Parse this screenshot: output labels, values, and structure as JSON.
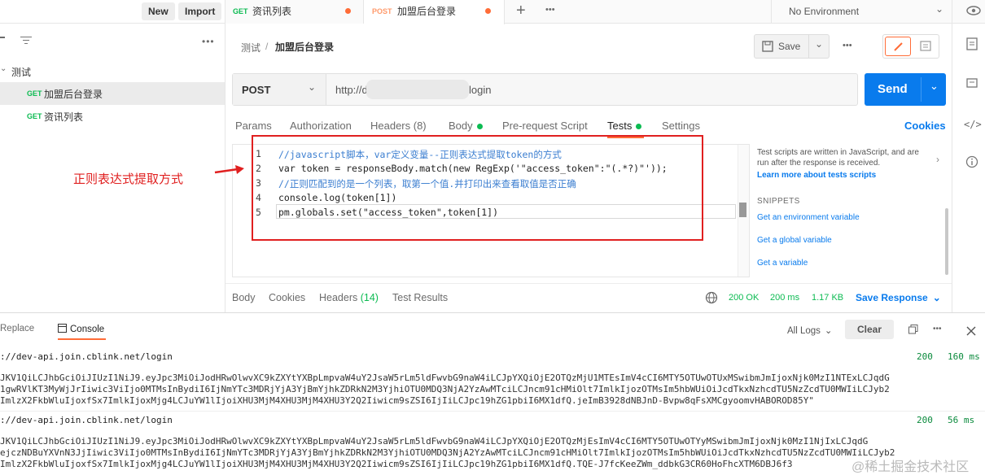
{
  "sidebar": {
    "new_label": "New",
    "import_label": "Import",
    "collection_name": "测试",
    "items": [
      {
        "method": "GET",
        "name": "加盟后台登录"
      },
      {
        "method": "GET",
        "name": "资讯列表"
      }
    ]
  },
  "tabs": [
    {
      "method": "GET",
      "name": "资讯列表"
    },
    {
      "method": "POST",
      "name": "加盟后台登录"
    }
  ],
  "environment": "No Environment",
  "breadcrumb": {
    "parent": "测试",
    "sep": "/",
    "current": "加盟后台登录"
  },
  "toolbar": {
    "save_label": "Save"
  },
  "request": {
    "method": "POST",
    "url_start": "http://d",
    "url_end": "login",
    "send_label": "Send"
  },
  "subtabs": {
    "params": "Params",
    "authorization": "Authorization",
    "headers": "Headers (8)",
    "body": "Body",
    "prerequest": "Pre-request Script",
    "tests": "Tests",
    "settings": "Settings",
    "cookies": "Cookies"
  },
  "editor": {
    "line_numbers": [
      "1",
      "2",
      "3",
      "4",
      "5"
    ],
    "lines": [
      "//javascript脚本，var定义变量--正则表达式提取token的方式",
      "var token = responseBody.match(new RegExp('\"access_token\":\"(.*?)\"'));",
      "//正则匹配到的是一个列表，取第一个值.并打印出来查看取值是否正确",
      "console.log(token[1])",
      "pm.globals.set(\"access_token\",token[1])"
    ]
  },
  "annotation": "正则表达式提取方式",
  "snippets_panel": {
    "desc": "Test scripts are written in JavaScript, and are run after the response is received.",
    "learn": "Learn more about tests scripts",
    "heading": "SNIPPETS",
    "items": [
      "Get an environment variable",
      "Get a global variable",
      "Get a variable"
    ]
  },
  "response": {
    "body": "Body",
    "cookies": "Cookies",
    "headers_label": "Headers",
    "headers_count": "(14)",
    "test_results": "Test Results",
    "status": "200 OK",
    "time": "200 ms",
    "size": "1.17 KB",
    "save_response": "Save Response"
  },
  "console": {
    "replace_tab": "Replace",
    "console_tab": "Console",
    "all_logs": "All Logs",
    "clear": "Clear",
    "entries": [
      {
        "url": "://dev-api.join.cblink.net/login",
        "status": "200",
        "time": "160 ms",
        "lines": [
          "JKV1QiLCJhbGciOiJIUzI1NiJ9.eyJpc3MiOiJodHRwOlwvXC9kZXYtYXBpLmpvaW4uY2JsaW5rLm5ldFwvbG9naW4iLCJpYXQiOjE2OTQzMjU1MTEsImV4cCI6MTY5OTUwOTUxMSwibmJmIjoxNjk0MzI1NTExLCJqdG",
          "1gwRVlKT3MyWjJrIiwic3ViIjo0MTMsInBydiI6IjNmYTc3MDRjYjA3YjBmYjhkZDRkN2M3YjhiOTU0MDQ3NjA2YzAwMTciLCJncm91cHMiOlt7ImlkIjozOTMsIm5hbWUiOiJcdTkxNzhcdTU5NzZcdTU0MWIiLCJyb2",
          "ImlzX2FkbWluIjoxfSx7ImlkIjoxMjg4LCJuYW1lIjoiXHU3MjM4XHU3MjM4XHU3Y2Q2Iiwicm9sZSI6IjIiLCJpc19hZG1pbiI6MX1dfQ.jeImB3928dNBJnD-Bvpw8qFsXMCgyoomvHABOROD85Y\""
        ]
      },
      {
        "url": "://dev-api.join.cblink.net/login",
        "status": "200",
        "time": "56 ms",
        "lines": [
          "JKV1QiLCJhbGciOiJIUzI1NiJ9.eyJpc3MiOiJodHRwOlwvXC9kZXYtYXBpLmpvaW4uY2JsaW5rLm5ldFwvbG9naW4iLCJpYXQiOjE2OTQzMjEsImV4cCI6MTY5OTUwOTYyMSwibmJmIjoxNjk0MzI1NjIxLCJqdG",
          "ejczNDBuYXVnN3JjIiwic3ViIjo0MTMsInBydiI6IjNmYTc3MDRjYjA3YjBmYjhkZDRkN2M3YjhiOTU0MDQ3NjA2YzAwMTciLCJncm91cHMiOlt7ImlkIjozOTMsIm5hbWUiOiJcdTkxNzhcdTU5NzZcdTU0MWIiLCJyb2",
          "ImlzX2FkbWluIjoxfSx7ImlkIjoxMjg4LCJuYW1lIjoiXHU3MjM4XHU3MjM4XHU3Y2Q2Iiwicm9sZSI6IjIiLCJpc19hZG1pbiI6MX1dfQ.TQE-J7fcKeeZWm_ddbkG3CR60HoFhcXTM6DBJ6f3"
        ]
      }
    ]
  },
  "watermark": "@稀土掘金技术社区"
}
